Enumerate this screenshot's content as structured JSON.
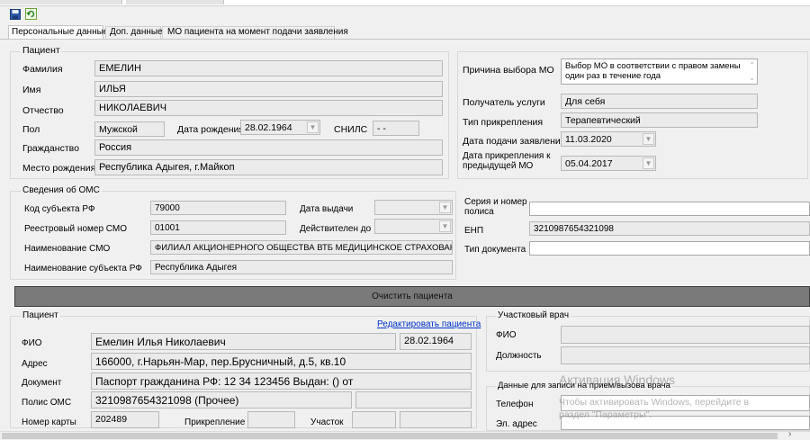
{
  "toolbar": {
    "save_icon": "save-icon",
    "refresh_icon": "refresh-icon"
  },
  "tabs": [
    {
      "label": "Персональные данные",
      "active": true
    },
    {
      "label": "Доп. данные",
      "active": false
    },
    {
      "label": "МО пациента на момент подачи заявления",
      "active": false
    }
  ],
  "patient_group": {
    "title": "Пациент",
    "surname_label": "Фамилия",
    "surname": "ЕМЕЛИН",
    "name_label": "Имя",
    "name": "ИЛЬЯ",
    "patronymic_label": "Отчество",
    "patronymic": "НИКОЛАЕВИЧ",
    "sex_label": "Пол",
    "sex": "Мужской",
    "birth_date_label": "Дата рождения",
    "birth_date": "28.02.1964",
    "snils_label": "СНИЛС",
    "snils": " -  -",
    "citizenship_label": "Гражданство",
    "citizenship": "Россия",
    "birthplace_label": "Место рождения",
    "birthplace": "Республика Адыгея, г.Майкоп"
  },
  "attachment": {
    "reason_label": "Причина выбора МО",
    "reason": "Выбор МО в соответствии с правом замены один раз в течение года",
    "recipient_label": "Получатель услуги",
    "recipient": "Для себя",
    "type_label": "Тип прикрепления",
    "type": "Терапевтический",
    "submit_date_label": "Дата подачи заявления",
    "submit_date": "11.03.2020",
    "prev_date_label": "Дата прикрепления к предыдущей МО",
    "prev_date": "05.04.2017"
  },
  "oms": {
    "title": "Сведения об ОМС",
    "subject_code_label": "Код субъекта РФ",
    "subject_code": "79000",
    "issue_date_label": "Дата выдачи",
    "issue_date": "",
    "registry_label": "Реестровый номер СМО",
    "registry": "01001",
    "valid_until_label": "Действителен до",
    "valid_until": "",
    "smo_name_label": "Наименование СМО",
    "smo_name": "ФИЛИАЛ АКЦИОНЕРНОГО ОБЩЕСТВА ВТБ МЕДИЦИНСКОЕ СТРАХОВАНИ",
    "subject_name_label": "Наименование субъекта РФ",
    "subject_name": "Республика Адыгея",
    "series_label": "Серия и номер полиса",
    "series": "",
    "enp_label": "ЕНП",
    "enp": "3210987654321098",
    "doc_type_label": "Тип документа",
    "doc_type": ""
  },
  "clear_button": "Очистить пациента",
  "patient_summary": {
    "title": "Пациент",
    "edit_link": "Редактировать пациента",
    "fio_label": "ФИО",
    "fio": "Емелин Илья Николаевич",
    "birth": "28.02.1964",
    "address_label": "Адрес",
    "address": "166000, г.Нарьян-Мар, пер.Брусничный, д.5, кв.10",
    "document_label": "Документ",
    "document": "Паспорт гражданина РФ: 12 34 123456 Выдан: () от",
    "policy_label": "Полис ОМС",
    "policy": "3210987654321098 (Прочее)",
    "card_label": "Номер карты",
    "card": "202489",
    "attach_label": "Прикрепление",
    "attach": "",
    "area_label": "Участок",
    "area": ""
  },
  "doctor": {
    "title": "Участковый врач",
    "fio_label": "ФИО",
    "fio": "",
    "position_label": "Должность",
    "position": ""
  },
  "appointment": {
    "title": "Данные для записи на прием/вызова врача",
    "phone_label": "Телефон",
    "phone": "",
    "email_label": "Эл. адрес",
    "email": ""
  },
  "watermark": {
    "line1": "Активация Windows",
    "line2": "Чтобы активировать Windows, перейдите в",
    "line3": "раздел \"Параметры\"."
  },
  "scroll_right_icon": "chevron-right-icon"
}
